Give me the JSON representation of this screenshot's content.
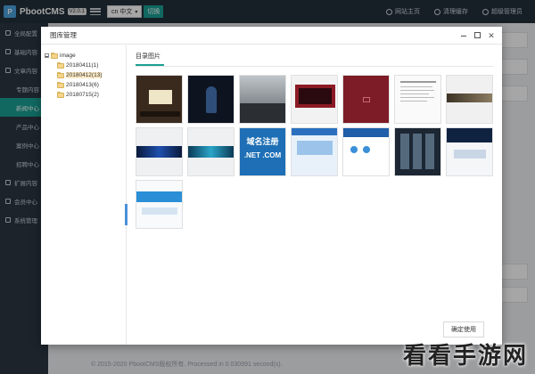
{
  "app": {
    "name": "PbootCMS",
    "version": "V2.0.1"
  },
  "topbar": {
    "lang": "cn 中文",
    "switch_label": "切换",
    "home_label": "网站主页",
    "cache_label": "清理缓存",
    "user_label": "超级管理员"
  },
  "sidebar": {
    "items": [
      {
        "label": "全局配置",
        "sub": false
      },
      {
        "label": "基础内容",
        "sub": false
      },
      {
        "label": "文章内容",
        "sub": false
      },
      {
        "label": "专题内容",
        "sub": true
      },
      {
        "label": "新闻中心",
        "sub": true,
        "active": true
      },
      {
        "label": "产品中心",
        "sub": true
      },
      {
        "label": "案例中心",
        "sub": true
      },
      {
        "label": "招聘中心",
        "sub": true
      },
      {
        "label": "扩展内容",
        "sub": false
      },
      {
        "label": "会员中心",
        "sub": false
      },
      {
        "label": "系统管理",
        "sub": false
      }
    ]
  },
  "footer": "© 2015-2020 PbootCMS版权所有. Processed in 0.030991 second(s).",
  "modal": {
    "title": "图库管理",
    "tree": {
      "root": "image",
      "folders": [
        {
          "label": "20180411(1)"
        },
        {
          "label": "20180412(13)",
          "selected": true
        },
        {
          "label": "20180413(6)"
        },
        {
          "label": "20180715(2)"
        }
      ]
    },
    "tab_label": "目录图片",
    "confirm_label": "确定使用",
    "thumbnails": [
      {
        "icon": "presentation-slide-thumbnail"
      },
      {
        "icon": "dark-portrait-thumbnail"
      },
      {
        "icon": "city-skyline-thumbnail"
      },
      {
        "icon": "red-device-thumbnail"
      },
      {
        "icon": "red-cover-thumbnail"
      },
      {
        "icon": "document-page-thumbnail"
      },
      {
        "icon": "landscape-strip-thumbnail"
      },
      {
        "icon": "blue-banner-thumbnail"
      },
      {
        "icon": "cyan-banner-thumbnail"
      },
      {
        "icon": "domain-register-thumbnail",
        "text": "域名注册"
      },
      {
        "icon": "website-screenshot-thumbnail"
      },
      {
        "icon": "browser-page-thumbnail"
      },
      {
        "icon": "server-rack-thumbnail"
      },
      {
        "icon": "dark-website-thumbnail"
      },
      {
        "icon": "web-template-thumbnail"
      }
    ]
  },
  "watermark": "看看手游网"
}
